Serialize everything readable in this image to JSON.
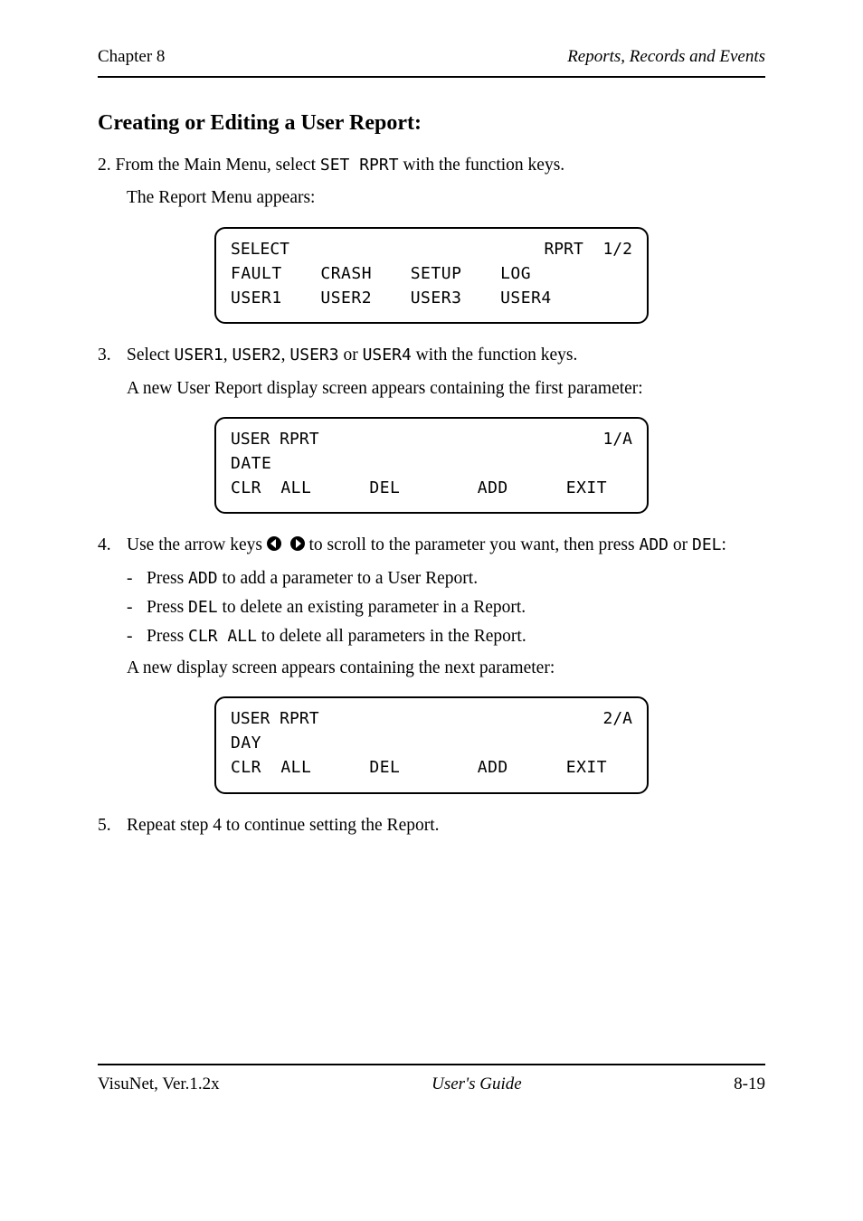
{
  "header": {
    "chapter_ref": "Chapter 8",
    "chapter_title": "Reports, Records and Events"
  },
  "section": {
    "title": "Creating or Editing a User Report:",
    "steps": {
      "s2": {
        "text_before_param": "2. From the Main Menu, select ",
        "param": "SET RPRT",
        "text_after_param": " with the function keys.",
        "followup": "The Report Menu appears:"
      },
      "s3": {
        "text_prefix": "Select ",
        "param1": "USER1",
        "text_mid1": ", ",
        "param2": "USER2",
        "text_mid2": ", ",
        "param3": "USER3",
        "text_mid3": " or ",
        "param4": "USER4",
        "text_suffix": " with the function keys.",
        "followup": "A new User Report display screen appears containing the first parameter:"
      },
      "s4": {
        "arrow_keys_text": "Use the arrow keys ",
        "arrow_left_name": "left-arrow-key",
        "arrow_right_name": "right-arrow-key",
        "after_arrows": " to scroll to the parameter you want, then press ",
        "param_add": "ADD",
        "or_text": " or ",
        "param_del": "DEL",
        "after_add_del": ":",
        "bullets": {
          "b1_before": "Press ",
          "b1_param": "ADD",
          "b1_after": " to add a parameter to a User Report.",
          "b2_before": "Press ",
          "b2_param": "DEL",
          "b2_after": " to delete an existing parameter in a Report.",
          "b3_before": "Press ",
          "b3_param": "CLR ALL",
          "b3_after": " to delete all parameters in the Report."
        },
        "followup": "A new display screen appears containing the next parameter:"
      },
      "s5": "Repeat step 4 to continue setting the Report."
    }
  },
  "displays": {
    "box1": {
      "line1_label": "SELECT",
      "line1_value": "RPRT  1/2",
      "line2": "FAULT  CRASH  SETUP  LOG",
      "line3": "USER1  USER2  USER3  USER4"
    },
    "box2": {
      "line1_label": "USER RPRT",
      "line1_value": "1/A",
      "line2": "DATE",
      "line3": "CLR ALL   DEL    ADD   EXIT"
    },
    "box3": {
      "line1_label": "USER RPRT",
      "line1_value": "2/A",
      "line2": "DAY",
      "line3": "CLR ALL   DEL    ADD   EXIT"
    }
  },
  "footer": {
    "left": "VisuNet, Ver.1.2x",
    "mid": "User's Guide",
    "right": "8-19"
  }
}
